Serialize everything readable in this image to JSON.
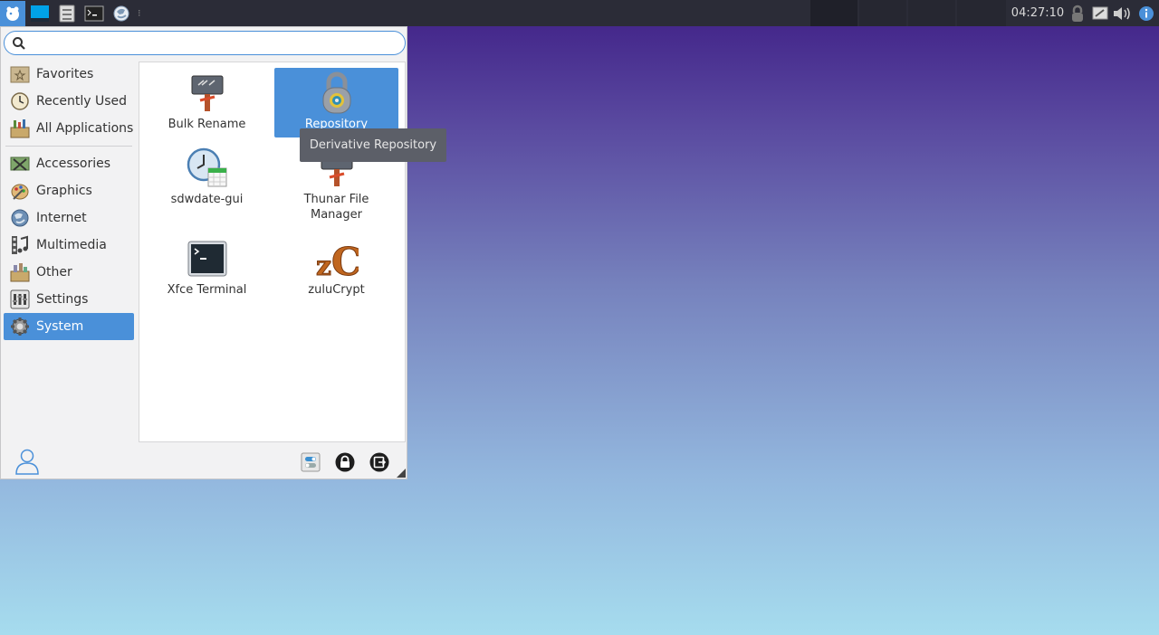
{
  "panel": {
    "clock": "04:27:10",
    "launchers": [
      "whisker-menu-icon",
      "desktop-icon",
      "file-manager-icon",
      "terminal-icon",
      "browser-icon"
    ]
  },
  "menu": {
    "search": {
      "value": "",
      "placeholder": ""
    },
    "categories": [
      {
        "label": "Favorites",
        "icon": "favorites-icon"
      },
      {
        "label": "Recently Used",
        "icon": "clock-icon"
      },
      {
        "label": "All Applications",
        "icon": "all-apps-icon"
      },
      {
        "label": "Accessories",
        "icon": "accessories-icon"
      },
      {
        "label": "Graphics",
        "icon": "graphics-icon"
      },
      {
        "label": "Internet",
        "icon": "internet-icon"
      },
      {
        "label": "Multimedia",
        "icon": "multimedia-icon"
      },
      {
        "label": "Other",
        "icon": "other-icon"
      },
      {
        "label": "Settings",
        "icon": "settings-icon"
      },
      {
        "label": "System",
        "icon": "system-icon",
        "selected": true
      }
    ],
    "apps": [
      {
        "label": "Bulk Rename",
        "icon": "bulk-rename-icon"
      },
      {
        "label": "Repository",
        "icon": "repository-icon",
        "selected": true
      },
      {
        "label": "sdwdate-gui",
        "icon": "sdwdate-icon"
      },
      {
        "label": "Thunar File Manager",
        "icon": "thunar-icon"
      },
      {
        "label": "Xfce Terminal",
        "icon": "xfce-terminal-icon"
      },
      {
        "label": "zuluCrypt",
        "icon": "zulucrypt-icon"
      }
    ],
    "tooltip": "Derivative Repository"
  },
  "colors": {
    "accent": "#4a90d9",
    "panel": "#2b2c37"
  }
}
